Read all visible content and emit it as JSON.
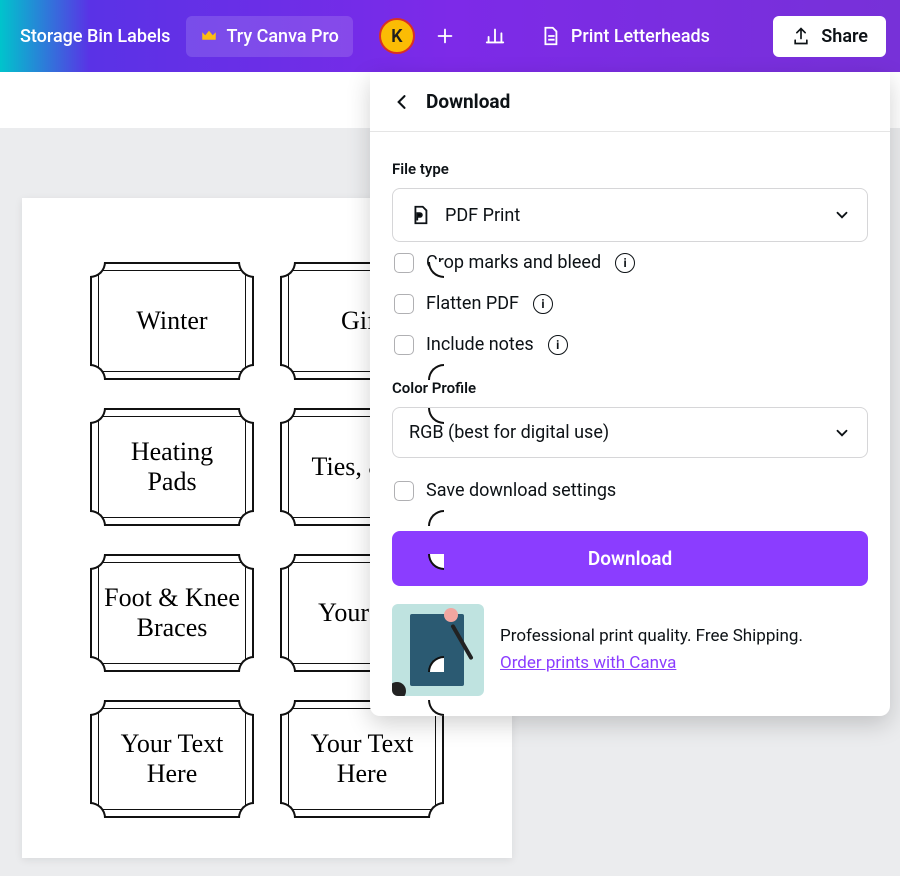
{
  "doc_title": "Storage Bin Labels",
  "topbar": {
    "try_pro": "Try Canva Pro",
    "avatar_initial": "K",
    "print": "Print Letterheads",
    "share": "Share"
  },
  "labels": [
    "Winter",
    "Gift",
    "Heating Pads",
    "Ties, & B",
    "Foot & Knee Braces",
    "Your He",
    "Your Text Here",
    "Your Text Here"
  ],
  "panel": {
    "title": "Download",
    "file_type_label": "File type",
    "file_type_value": "PDF Print",
    "crop_marks": "Crop marks and bleed",
    "flatten": "Flatten PDF",
    "include_notes": "Include notes",
    "color_profile_label": "Color Profile",
    "color_profile_value": "RGB (best for digital use)",
    "save_settings": "Save download settings",
    "download_btn": "Download",
    "promo_line": "Professional print quality. Free Shipping.",
    "promo_link": "Order prints with Canva"
  }
}
